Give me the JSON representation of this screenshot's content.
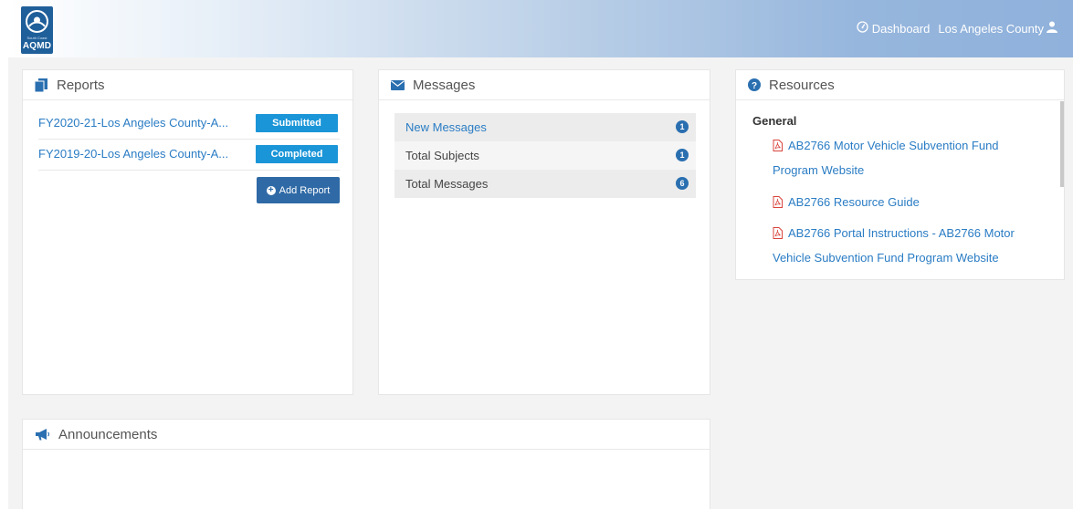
{
  "brand": {
    "logo_small": "South Coast",
    "logo_text": "AQMD"
  },
  "topnav": {
    "dashboard": "Dashboard",
    "user": "Los Angeles County"
  },
  "reports": {
    "title": "Reports",
    "items": [
      {
        "name": "FY2020-21-Los Angeles County-A...",
        "status": "Submitted"
      },
      {
        "name": "FY2019-20-Los Angeles County-A...",
        "status": "Completed"
      }
    ],
    "add_label": "Add Report"
  },
  "messages": {
    "title": "Messages",
    "rows": [
      {
        "label": "New Messages",
        "count": "1"
      },
      {
        "label": "Total Subjects",
        "count": "1"
      },
      {
        "label": "Total Messages",
        "count": "6"
      }
    ]
  },
  "resources": {
    "title": "Resources",
    "section": "General",
    "links": [
      "AB2766 Motor Vehicle Subvention Fund Program Website",
      "AB2766 Resource Guide",
      "AB2766 Portal Instructions - AB2766 Motor Vehicle Subvention Fund Program Website"
    ]
  },
  "announcements": {
    "title": "Announcements"
  },
  "colors": {
    "accent": "#2a7cc4",
    "badge": "#1a95d8",
    "button": "#2f6aa6",
    "pdf": "#d9443c"
  }
}
